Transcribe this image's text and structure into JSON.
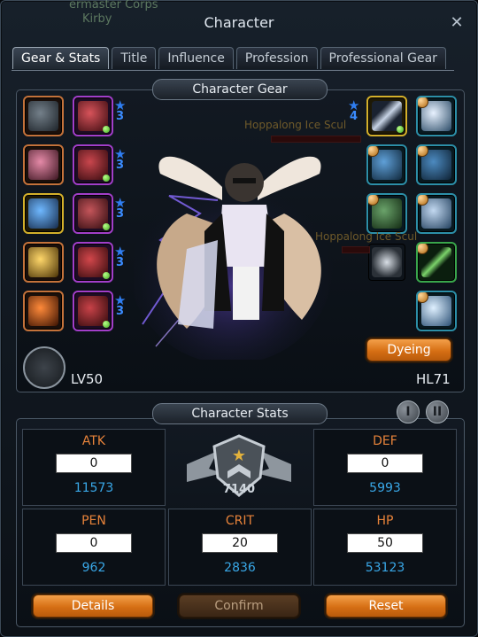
{
  "background_names": [
    "ermaster Corps",
    "Kirby"
  ],
  "window": {
    "title": "Character",
    "close_icon": "close-icon"
  },
  "tabs": [
    "Gear & Stats",
    "Title",
    "Influence",
    "Profession",
    "Professional Gear"
  ],
  "active_tab": "Gear & Stats",
  "gear": {
    "header": "Character Gear",
    "left_plus": [
      "3",
      "3",
      "3",
      "3",
      "3"
    ],
    "right_plus": "4",
    "npc_labels": [
      "Hoppalong Ice Scul",
      "Hoppalong Ice Scul"
    ],
    "level": "LV50",
    "hero_level": "HL71",
    "dyeing_button": "Dyeing"
  },
  "stats": {
    "header": "Character Stats",
    "page_buttons": [
      "I",
      "II"
    ],
    "emblem_value": "7140",
    "boxes": [
      {
        "name": "ATK",
        "input": "0",
        "value": "11573"
      },
      {
        "name": "DEF",
        "input": "0",
        "value": "5993"
      },
      {
        "name": "PEN",
        "input": "0",
        "value": "962"
      },
      {
        "name": "CRIT",
        "input": "20",
        "value": "2836"
      },
      {
        "name": "HP",
        "input": "50",
        "value": "53123"
      }
    ],
    "buttons": {
      "details": "Details",
      "confirm": "Confirm",
      "reset": "Reset"
    }
  },
  "colors": {
    "accent_orange": "#d66f14",
    "stat_label": "#e8833a",
    "stat_value": "#39a8e8",
    "plus_blue": "#2f7df0"
  }
}
